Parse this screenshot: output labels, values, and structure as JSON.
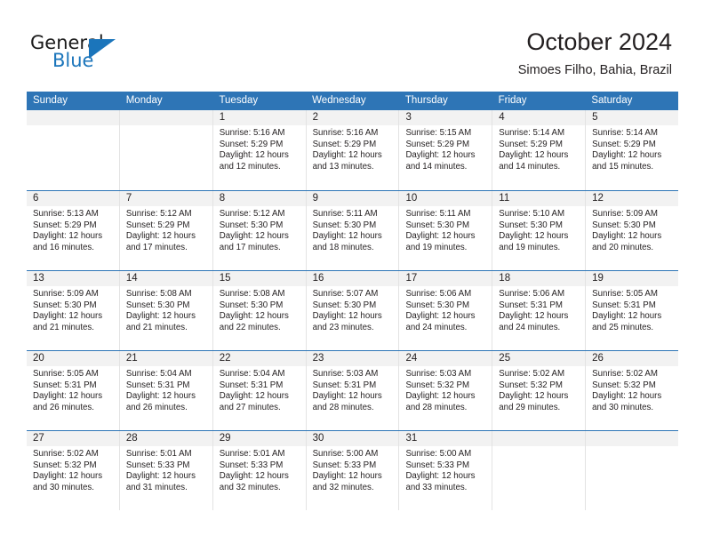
{
  "logo": {
    "text_primary": "General",
    "text_secondary": "Blue",
    "triangle_color": "#1b75bb"
  },
  "header": {
    "month_title": "October 2024",
    "location": "Simoes Filho, Bahia, Brazil"
  },
  "theme": {
    "header_blue": "#2e75b6",
    "daynum_gray": "#f2f2f2",
    "grid_line": "#e3e3e3",
    "text": "#231f20"
  },
  "weekdays": [
    "Sunday",
    "Monday",
    "Tuesday",
    "Wednesday",
    "Thursday",
    "Friday",
    "Saturday"
  ],
  "labels": {
    "sunrise_prefix": "Sunrise: ",
    "sunset_prefix": "Sunset: ",
    "daylight_prefix": "Daylight: "
  },
  "weeks": [
    [
      {
        "day": "",
        "empty": true
      },
      {
        "day": "",
        "empty": true
      },
      {
        "day": "1",
        "sunrise": "Sunrise: 5:16 AM",
        "sunset": "Sunset: 5:29 PM",
        "daylight": "Daylight: 12 hours and 12 minutes."
      },
      {
        "day": "2",
        "sunrise": "Sunrise: 5:16 AM",
        "sunset": "Sunset: 5:29 PM",
        "daylight": "Daylight: 12 hours and 13 minutes."
      },
      {
        "day": "3",
        "sunrise": "Sunrise: 5:15 AM",
        "sunset": "Sunset: 5:29 PM",
        "daylight": "Daylight: 12 hours and 14 minutes."
      },
      {
        "day": "4",
        "sunrise": "Sunrise: 5:14 AM",
        "sunset": "Sunset: 5:29 PM",
        "daylight": "Daylight: 12 hours and 14 minutes."
      },
      {
        "day": "5",
        "sunrise": "Sunrise: 5:14 AM",
        "sunset": "Sunset: 5:29 PM",
        "daylight": "Daylight: 12 hours and 15 minutes."
      }
    ],
    [
      {
        "day": "6",
        "sunrise": "Sunrise: 5:13 AM",
        "sunset": "Sunset: 5:29 PM",
        "daylight": "Daylight: 12 hours and 16 minutes."
      },
      {
        "day": "7",
        "sunrise": "Sunrise: 5:12 AM",
        "sunset": "Sunset: 5:29 PM",
        "daylight": "Daylight: 12 hours and 17 minutes."
      },
      {
        "day": "8",
        "sunrise": "Sunrise: 5:12 AM",
        "sunset": "Sunset: 5:30 PM",
        "daylight": "Daylight: 12 hours and 17 minutes."
      },
      {
        "day": "9",
        "sunrise": "Sunrise: 5:11 AM",
        "sunset": "Sunset: 5:30 PM",
        "daylight": "Daylight: 12 hours and 18 minutes."
      },
      {
        "day": "10",
        "sunrise": "Sunrise: 5:11 AM",
        "sunset": "Sunset: 5:30 PM",
        "daylight": "Daylight: 12 hours and 19 minutes."
      },
      {
        "day": "11",
        "sunrise": "Sunrise: 5:10 AM",
        "sunset": "Sunset: 5:30 PM",
        "daylight": "Daylight: 12 hours and 19 minutes."
      },
      {
        "day": "12",
        "sunrise": "Sunrise: 5:09 AM",
        "sunset": "Sunset: 5:30 PM",
        "daylight": "Daylight: 12 hours and 20 minutes."
      }
    ],
    [
      {
        "day": "13",
        "sunrise": "Sunrise: 5:09 AM",
        "sunset": "Sunset: 5:30 PM",
        "daylight": "Daylight: 12 hours and 21 minutes."
      },
      {
        "day": "14",
        "sunrise": "Sunrise: 5:08 AM",
        "sunset": "Sunset: 5:30 PM",
        "daylight": "Daylight: 12 hours and 21 minutes."
      },
      {
        "day": "15",
        "sunrise": "Sunrise: 5:08 AM",
        "sunset": "Sunset: 5:30 PM",
        "daylight": "Daylight: 12 hours and 22 minutes."
      },
      {
        "day": "16",
        "sunrise": "Sunrise: 5:07 AM",
        "sunset": "Sunset: 5:30 PM",
        "daylight": "Daylight: 12 hours and 23 minutes."
      },
      {
        "day": "17",
        "sunrise": "Sunrise: 5:06 AM",
        "sunset": "Sunset: 5:30 PM",
        "daylight": "Daylight: 12 hours and 24 minutes."
      },
      {
        "day": "18",
        "sunrise": "Sunrise: 5:06 AM",
        "sunset": "Sunset: 5:31 PM",
        "daylight": "Daylight: 12 hours and 24 minutes."
      },
      {
        "day": "19",
        "sunrise": "Sunrise: 5:05 AM",
        "sunset": "Sunset: 5:31 PM",
        "daylight": "Daylight: 12 hours and 25 minutes."
      }
    ],
    [
      {
        "day": "20",
        "sunrise": "Sunrise: 5:05 AM",
        "sunset": "Sunset: 5:31 PM",
        "daylight": "Daylight: 12 hours and 26 minutes."
      },
      {
        "day": "21",
        "sunrise": "Sunrise: 5:04 AM",
        "sunset": "Sunset: 5:31 PM",
        "daylight": "Daylight: 12 hours and 26 minutes."
      },
      {
        "day": "22",
        "sunrise": "Sunrise: 5:04 AM",
        "sunset": "Sunset: 5:31 PM",
        "daylight": "Daylight: 12 hours and 27 minutes."
      },
      {
        "day": "23",
        "sunrise": "Sunrise: 5:03 AM",
        "sunset": "Sunset: 5:31 PM",
        "daylight": "Daylight: 12 hours and 28 minutes."
      },
      {
        "day": "24",
        "sunrise": "Sunrise: 5:03 AM",
        "sunset": "Sunset: 5:32 PM",
        "daylight": "Daylight: 12 hours and 28 minutes."
      },
      {
        "day": "25",
        "sunrise": "Sunrise: 5:02 AM",
        "sunset": "Sunset: 5:32 PM",
        "daylight": "Daylight: 12 hours and 29 minutes."
      },
      {
        "day": "26",
        "sunrise": "Sunrise: 5:02 AM",
        "sunset": "Sunset: 5:32 PM",
        "daylight": "Daylight: 12 hours and 30 minutes."
      }
    ],
    [
      {
        "day": "27",
        "sunrise": "Sunrise: 5:02 AM",
        "sunset": "Sunset: 5:32 PM",
        "daylight": "Daylight: 12 hours and 30 minutes."
      },
      {
        "day": "28",
        "sunrise": "Sunrise: 5:01 AM",
        "sunset": "Sunset: 5:33 PM",
        "daylight": "Daylight: 12 hours and 31 minutes."
      },
      {
        "day": "29",
        "sunrise": "Sunrise: 5:01 AM",
        "sunset": "Sunset: 5:33 PM",
        "daylight": "Daylight: 12 hours and 32 minutes."
      },
      {
        "day": "30",
        "sunrise": "Sunrise: 5:00 AM",
        "sunset": "Sunset: 5:33 PM",
        "daylight": "Daylight: 12 hours and 32 minutes."
      },
      {
        "day": "31",
        "sunrise": "Sunrise: 5:00 AM",
        "sunset": "Sunset: 5:33 PM",
        "daylight": "Daylight: 12 hours and 33 minutes."
      },
      {
        "day": "",
        "empty": true
      },
      {
        "day": "",
        "empty": true
      }
    ]
  ]
}
